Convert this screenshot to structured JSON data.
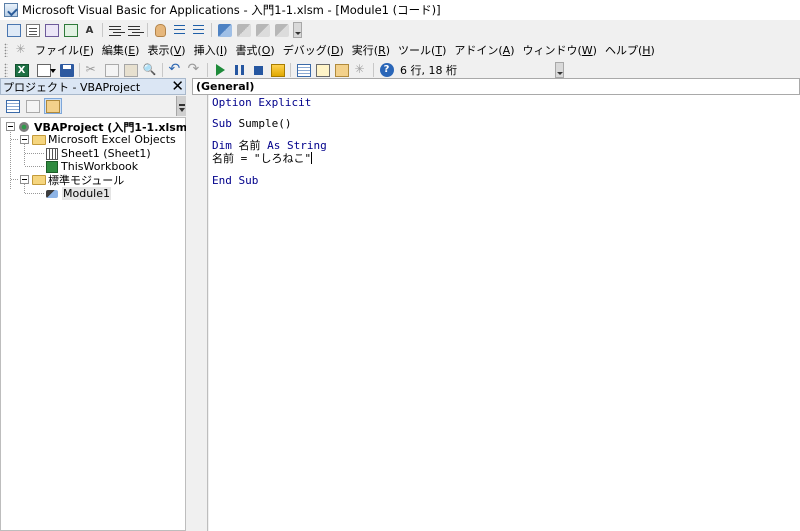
{
  "window": {
    "title": "Microsoft Visual Basic for Applications - 入門1-1.xlsm - [Module1 (コード)]"
  },
  "menu": {
    "items": [
      {
        "label": "ファイル(",
        "key": "F",
        "end": ")"
      },
      {
        "label": "編集(",
        "key": "E",
        "end": ")"
      },
      {
        "label": "表示(",
        "key": "V",
        "end": ")"
      },
      {
        "label": "挿入(",
        "key": "I",
        "end": ")"
      },
      {
        "label": "書式(",
        "key": "O",
        "end": ")"
      },
      {
        "label": "デバッグ(",
        "key": "D",
        "end": ")"
      },
      {
        "label": "実行(",
        "key": "R",
        "end": ")"
      },
      {
        "label": "ツール(",
        "key": "T",
        "end": ")"
      },
      {
        "label": "アドイン(",
        "key": "A",
        "end": ")"
      },
      {
        "label": "ウィンドウ(",
        "key": "W",
        "end": ")"
      },
      {
        "label": "ヘルプ(",
        "key": "H",
        "end": ")"
      }
    ]
  },
  "edit_toolbar": {
    "text_icon": "A"
  },
  "standard_toolbar": {
    "position_text": "6 行, 18 桁",
    "excel_icon_letter": "X",
    "help_icon_glyph": "?"
  },
  "project_pane": {
    "title": "プロジェクト - VBAProject",
    "close_glyph": "✕",
    "tree": {
      "project": "VBAProject (入門1-1.xlsm)",
      "excel_objects": "Microsoft Excel Objects",
      "sheet1": "Sheet1 (Sheet1)",
      "workbook": "ThisWorkbook",
      "modules_folder": "標準モジュール",
      "module1": "Module1"
    }
  },
  "code_window": {
    "object_combo": "(General)",
    "lines": {
      "l1_kw": "Option Explicit",
      "l3_kw": "Sub",
      "l3_rest": " Sumple()",
      "l5_kw1": "Dim",
      "l5_mid": " 名前 ",
      "l5_kw2": "As String",
      "l6": "名前 = \"しろねこ\"",
      "l8_kw": "End Sub"
    }
  },
  "colors": {
    "keyword": "#00008b",
    "pane_header": "#dbe6f4"
  }
}
